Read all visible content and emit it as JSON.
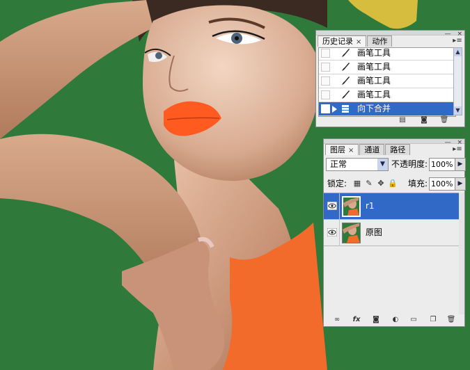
{
  "history_panel": {
    "tabs": [
      {
        "label": "历史记录",
        "close": "×",
        "active": true
      },
      {
        "label": "动作",
        "active": false
      }
    ],
    "panel_controls": {
      "minimize": "—",
      "close": "×"
    },
    "menu_icon": "menu-icon",
    "items": [
      {
        "label": "画笔工具",
        "icon": "brush-icon",
        "selected": false
      },
      {
        "label": "画笔工具",
        "icon": "brush-icon",
        "selected": false
      },
      {
        "label": "画笔工具",
        "icon": "brush-icon",
        "selected": false
      },
      {
        "label": "画笔工具",
        "icon": "brush-icon",
        "selected": false
      },
      {
        "label": "向下合并",
        "icon": "layers-merge-icon",
        "selected": true
      }
    ],
    "footer_icons": [
      "new-document-from-state-icon",
      "new-snapshot-icon",
      "trash-icon"
    ]
  },
  "layers_panel": {
    "tabs": [
      {
        "label": "图层",
        "close": "×",
        "active": true
      },
      {
        "label": "通道",
        "active": false
      },
      {
        "label": "路径",
        "active": false
      }
    ],
    "panel_controls": {
      "minimize": "—",
      "close": "×"
    },
    "blend_mode": "正常",
    "opacity_label": "不透明度:",
    "opacity_value": "100%",
    "lock_label": "锁定:",
    "lock_icons": [
      "lock-transparent-icon",
      "lock-image-icon",
      "lock-position-icon",
      "lock-all-icon"
    ],
    "fill_label": "填充:",
    "fill_value": "100%",
    "layers": [
      {
        "name": "r1",
        "visible": true,
        "selected": true
      },
      {
        "name": "原图",
        "visible": true,
        "selected": false
      }
    ],
    "footer_icons": [
      "link-layers-icon",
      "fx-icon",
      "layer-mask-icon",
      "adjustment-layer-icon",
      "group-folder-icon",
      "new-layer-icon",
      "trash-icon"
    ],
    "fx_label": "fx"
  },
  "colors": {
    "background_green": "#2f7a3a",
    "selection_blue": "#3169c6",
    "skin": "#d6a98d",
    "lips": "#ff5a1f",
    "top": "#f26b2a"
  }
}
